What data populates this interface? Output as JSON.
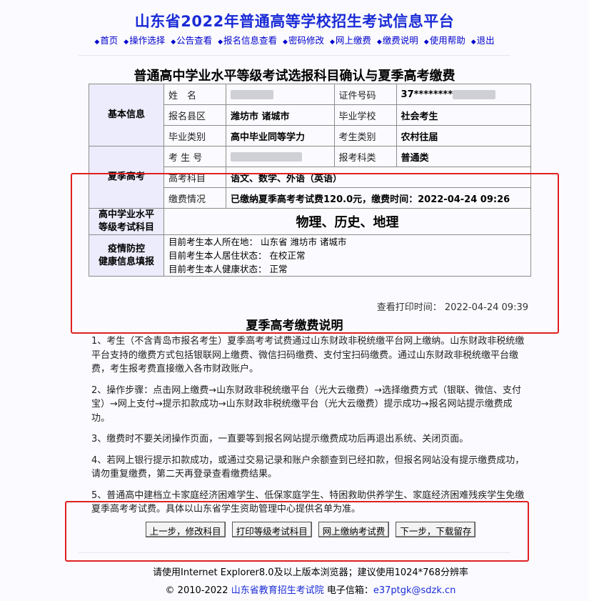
{
  "header": {
    "title": "山东省2022年普通高等学校招生考试信息平台",
    "nav": [
      "首页",
      "操作选择",
      "公告查看",
      "报名信息查看",
      "密码修改",
      "网上缴费",
      "缴费说明",
      "使用帮助",
      "退出"
    ]
  },
  "page_title": "普通高中学业水平等级考试选报科目确认与夏季高考缴费",
  "basic": {
    "section": "基本信息",
    "name_label": "姓　名",
    "id_label": "证件号码",
    "id_value": "37********",
    "county_label": "报名县区",
    "county_value": "潍坊市 诸城市",
    "school_label": "毕业学校",
    "school_value": "社会考生",
    "grad_type_label": "毕业类别",
    "grad_type_value": "高中毕业同等学力",
    "exam_type_label": "考生类别",
    "exam_type_value": "农村往届"
  },
  "gaokao": {
    "section": "夏季高考",
    "num_label": "考 生 号",
    "category_label": "报考科类",
    "category_value": "普通类",
    "subjects_label": "高考科目",
    "subjects_value": "语文、数学、外语（英语）",
    "payment_label": "缴费情况",
    "payment_value": "已缴纳夏季高考考试费120.0元，缴费时间：2022-04-24 09:26"
  },
  "level": {
    "section_line1": "高中学业水平",
    "section_line2": "等级考试科目",
    "subjects": "物理、历史、地理"
  },
  "health": {
    "section_line1": "疫情防控",
    "section_line2": "健康信息填报",
    "line1": "目前考生本人所在地：  山东省 潍坊市 诸城市",
    "line2": "目前考生本人居住状态：  在校正常",
    "line3": "目前考生本人健康状态：  正常"
  },
  "print_time": "查看打印时间：  2022-04-24 09:39",
  "notes": {
    "title": "夏季高考缴费说明",
    "items": [
      "1、考生（不含青岛市报名考生）夏季高考考试费通过山东财政非税统缴平台网上缴纳。山东财政非税统缴平台支持的缴费方式包括银联网上缴费、微信扫码缴费、支付宝扫码缴费。通过山东财政非税统缴平台缴费，考生报考费直接缴入各市财政账户。",
      "2、操作步骤：点击网上缴费→山东财政非税统缴平台（光大云缴费）→选择缴费方式（银联、微信、支付宝）→网上支付→提示扣款成功→山东财政非税统缴平台（光大云缴费）提示成功→报名网站提示缴费成功。",
      "3、缴费时不要关闭操作页面，一直要等到报名网站提示缴费成功后再退出系统、关闭页面。",
      "4、若网上银行提示扣款成功，或通过交易记录和账户余额查到已经扣款，但报名网站没有提示缴费成功，请勿重复缴费，第二天再登录查看缴费结果。",
      "5、普通高中建档立卡家庭经济困难学生、低保家庭学生、特困救助供养学生、家庭经济困难残疾学生免缴夏季高考考试费。具体以山东省学生资助管理中心提供名单为准。"
    ]
  },
  "buttons": {
    "prev": "上一步，修改科目",
    "print": "打印等级考试科目",
    "pay": "网上缴纳考试费",
    "next": "下一步，下载留存"
  },
  "footer": {
    "browser_note": "请使用Internet Explorer8.0及以上版本浏览器；建议使用1024*768分辨率",
    "copyright": "© 2010-2022",
    "org": "山东省教育招生考试院",
    "email_label": "电子信箱：",
    "email": "e37ptgk@sdzk.cn"
  },
  "colors": {
    "title": "#1a2bd6",
    "section_bg": "#ececfc",
    "highlight": "#e02020"
  }
}
